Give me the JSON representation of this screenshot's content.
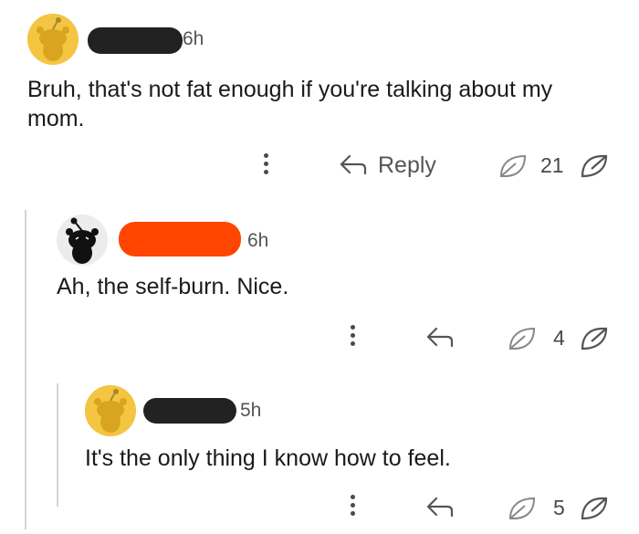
{
  "comments": [
    {
      "avatar_color": "#f4c542",
      "username_redaction_color": "#222222",
      "time": "6h",
      "text": "Bruh, that's not fat enough if you're talking about my mom.",
      "reply_label": "Reply",
      "votes": "21"
    },
    {
      "avatar_color": "#222222",
      "username_redaction_color": "#ff4500",
      "time": "6h",
      "text": "Ah, the self-burn. Nice.",
      "votes": "4"
    },
    {
      "avatar_color": "#f4c542",
      "username_redaction_color": "#222222",
      "time": "5h",
      "text": "It's the only thing I know how to feel.",
      "votes": "5"
    }
  ],
  "icons": {
    "more": "more-options-icon",
    "reply": "reply-arrow-icon",
    "upvote": "upvote-leaf-icon",
    "downvote": "downvote-leaf-icon"
  }
}
